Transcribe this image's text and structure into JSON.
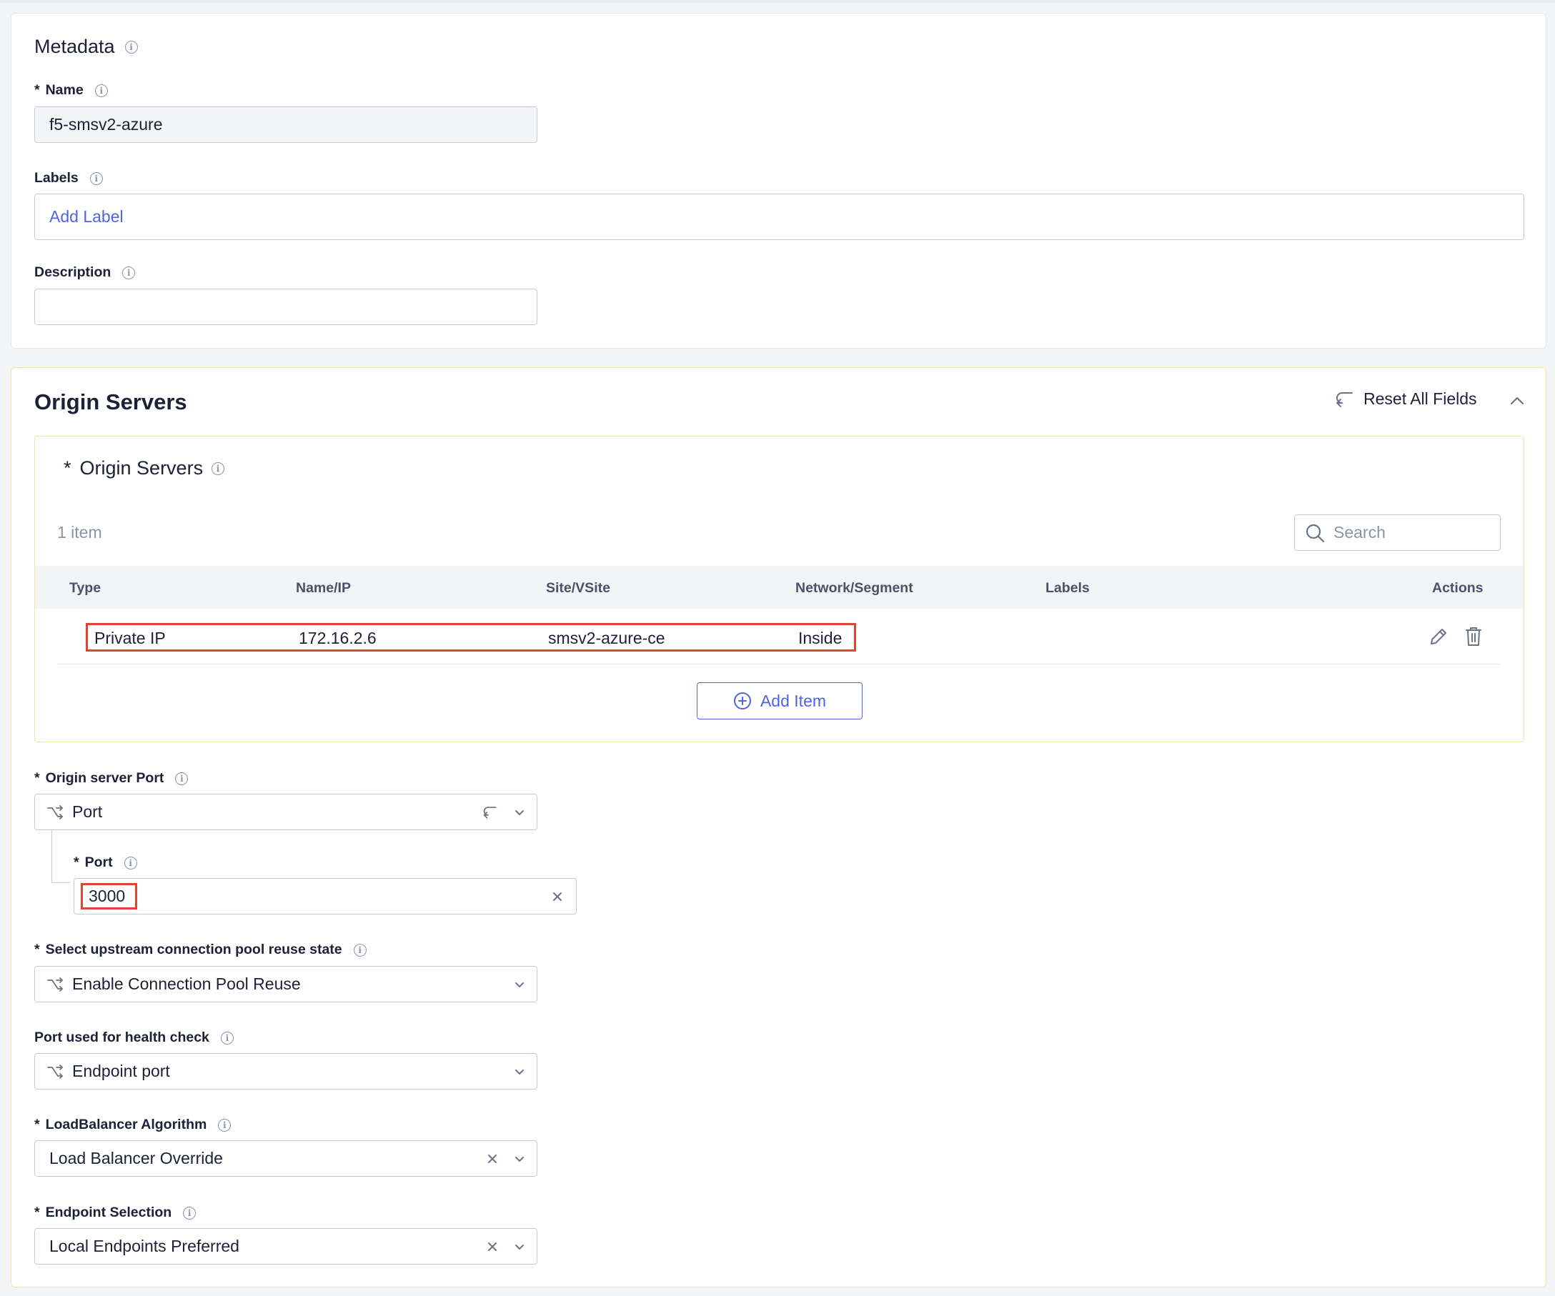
{
  "metadata": {
    "title": "Metadata",
    "name_label": "Name",
    "name_value": "f5-smsv2-azure",
    "labels_label": "Labels",
    "add_label": "Add Label",
    "description_label": "Description",
    "description_value": ""
  },
  "origin_section": {
    "title": "Origin Servers",
    "reset_label": "Reset All Fields",
    "list_title": "Origin Servers",
    "item_count": "1 item",
    "search_placeholder": "Search",
    "columns": [
      "Type",
      "Name/IP",
      "Site/VSite",
      "Network/Segment",
      "Labels",
      "Actions"
    ],
    "rows": [
      {
        "type": "Private IP",
        "name_ip": "172.16.2.6",
        "site": "smsv2-azure-ce",
        "network": "Inside",
        "labels": ""
      }
    ],
    "add_item_label": "Add Item"
  },
  "fields": {
    "origin_port_label": "Origin server Port",
    "origin_port_value": "Port",
    "port_label": "Port",
    "port_value": "3000",
    "pool_reuse_label": "Select upstream connection pool reuse state",
    "pool_reuse_value": "Enable Connection Pool Reuse",
    "health_check_label": "Port used for health check",
    "health_check_value": "Endpoint port",
    "lb_algorithm_label": "LoadBalancer Algorithm",
    "lb_algorithm_value": "Load Balancer Override",
    "endpoint_selection_label": "Endpoint Selection",
    "endpoint_selection_value": "Local Endpoints Preferred"
  },
  "colors": {
    "accent": "#4f63e3",
    "highlight": "#e1452e",
    "warning_border": "#f4e3a8",
    "text": "#1b2136"
  },
  "icons": {
    "info": "info-icon",
    "select": "branch-icon",
    "reset": "reset-icon",
    "collapse": "chevron-up-icon",
    "search": "search-icon",
    "edit": "pencil-icon",
    "delete": "trash-icon",
    "add": "plus-circle-icon",
    "clear": "close-icon",
    "dropdown": "chevron-down-icon"
  }
}
